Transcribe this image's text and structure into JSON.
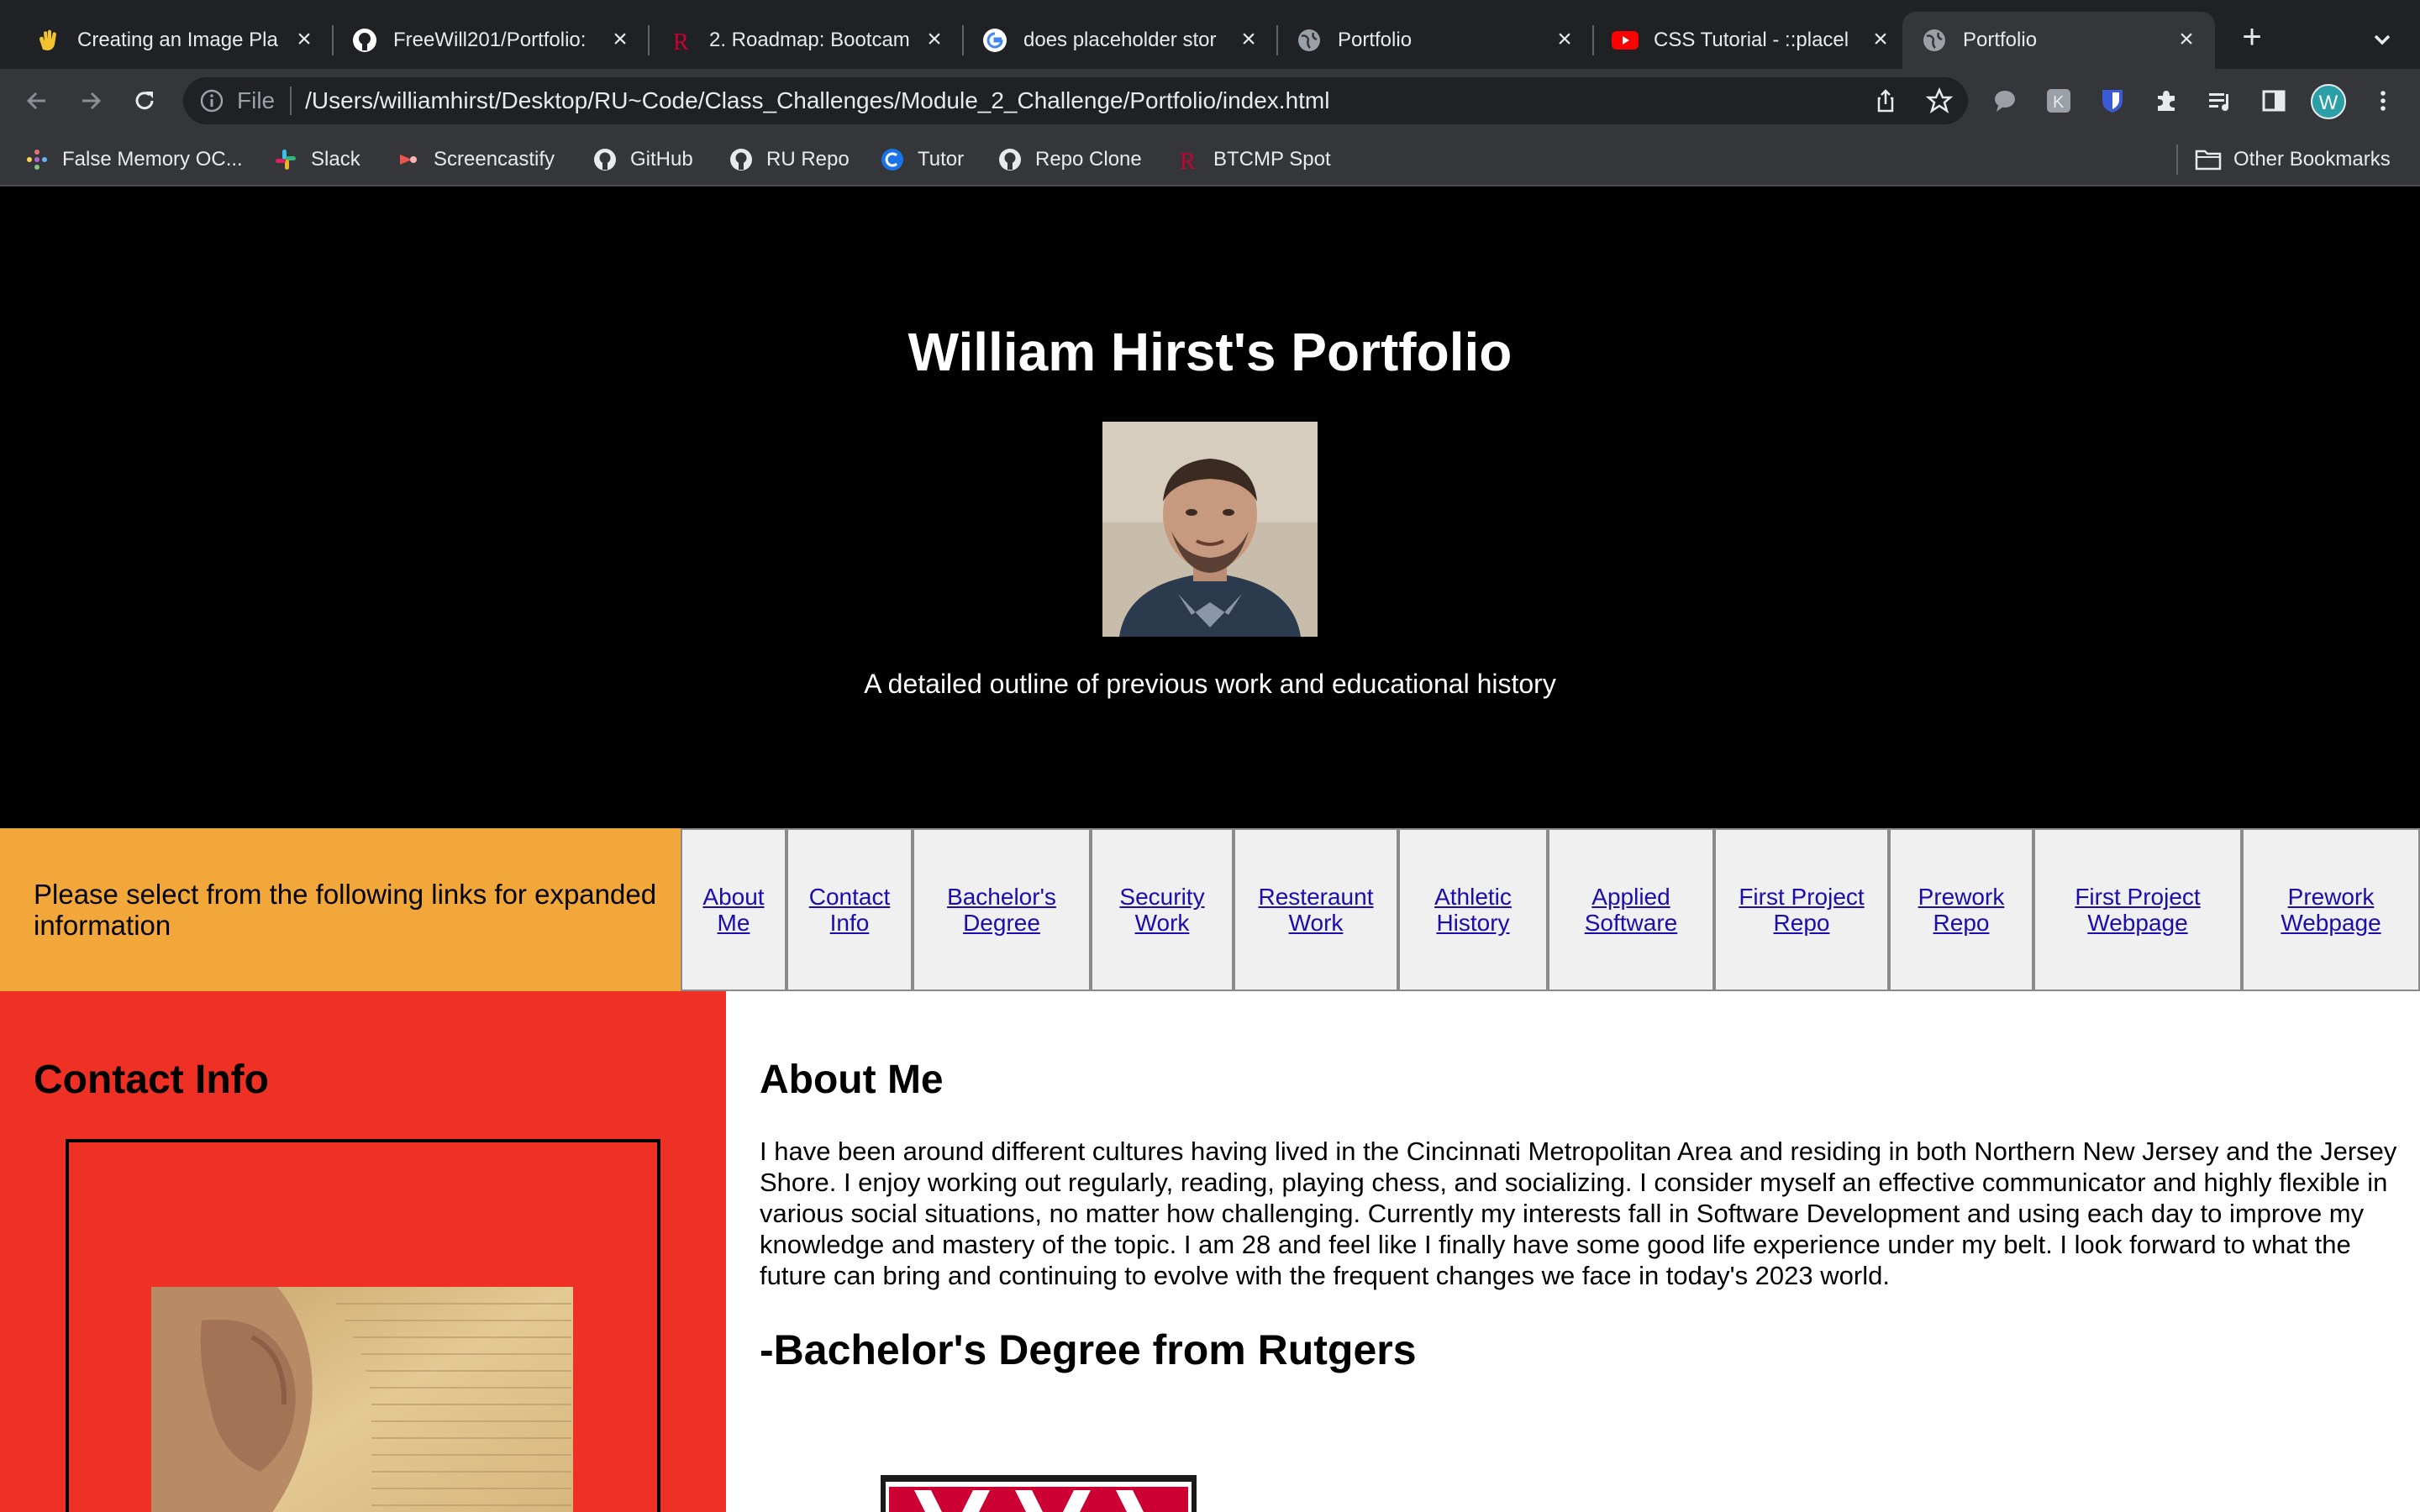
{
  "browser": {
    "tabs": [
      {
        "title": "Creating an Image Pla",
        "icon": "wave-hand-icon"
      },
      {
        "title": "FreeWill201/Portfolio:",
        "icon": "github-icon"
      },
      {
        "title": "2. Roadmap: Bootcam",
        "icon": "rutgers-r-icon"
      },
      {
        "title": "does placeholder stor",
        "icon": "google-icon"
      },
      {
        "title": "Portfolio",
        "icon": "globe-icon"
      },
      {
        "title": "CSS Tutorial - ::placel",
        "icon": "youtube-icon"
      },
      {
        "title": "Portfolio",
        "icon": "globe-icon",
        "active": true
      }
    ],
    "address": {
      "scheme": "File",
      "url": "/Users/williamhirst/Desktop/RU~Code/Class_Challenges/Module_2_Challenge/Portfolio/index.html"
    },
    "avatar_letter": "W",
    "bookmarks": [
      {
        "label": "False Memory OC...",
        "icon": "dots-icon"
      },
      {
        "label": "Slack",
        "icon": "slack-icon"
      },
      {
        "label": "Screencastify",
        "icon": "screencastify-icon"
      },
      {
        "label": "GitHub",
        "icon": "github-icon"
      },
      {
        "label": "RU Repo",
        "icon": "github-icon"
      },
      {
        "label": "Tutor",
        "icon": "tutor-icon"
      },
      {
        "label": "Repo Clone",
        "icon": "github-icon"
      },
      {
        "label": "BTCMP Spot",
        "icon": "rutgers-r-icon"
      }
    ],
    "other_bookmarks": "Other Bookmarks"
  },
  "page": {
    "title": "William Hirst's Portfolio",
    "tagline": "A detailed outline of previous work and educational history",
    "nav_prompt": "Please select from the following links for expanded information",
    "nav_links": [
      "About Me",
      "Contact Info",
      "Bachelor's Degree",
      "Security Work",
      "Resteraunt Work",
      "Athletic History",
      "Applied Software",
      "First Project Repo",
      "Prework Repo",
      "First Project Webpage",
      "Prework Webpage"
    ],
    "sidebar_heading": "Contact Info",
    "about_heading": "About Me",
    "about_text": "I have been around different cultures having lived in the Cincinnati Metropolitan Area and residing in both Northern New Jersey and the Jersey Shore. I enjoy working out regularly, reading, playing chess, and socializing. I consider myself an effective communicator and highly flexible in various social situations, no matter how challenging. Currently my interests fall in Software Development and using each day to improve my knowledge and mastery of the topic. I am 28 and feel like I finally have some good life experience under my belt. I look forward to what the future can bring and continuing to evolve with the frequent changes we face in today's 2023 world.",
    "degree_heading": "-Bachelor's Degree from Rutgers"
  },
  "colors": {
    "hero_bg": "#000000",
    "nav_bg": "#f2a73b",
    "sidebar_bg": "#ee3124",
    "link": "#1a0dab"
  }
}
